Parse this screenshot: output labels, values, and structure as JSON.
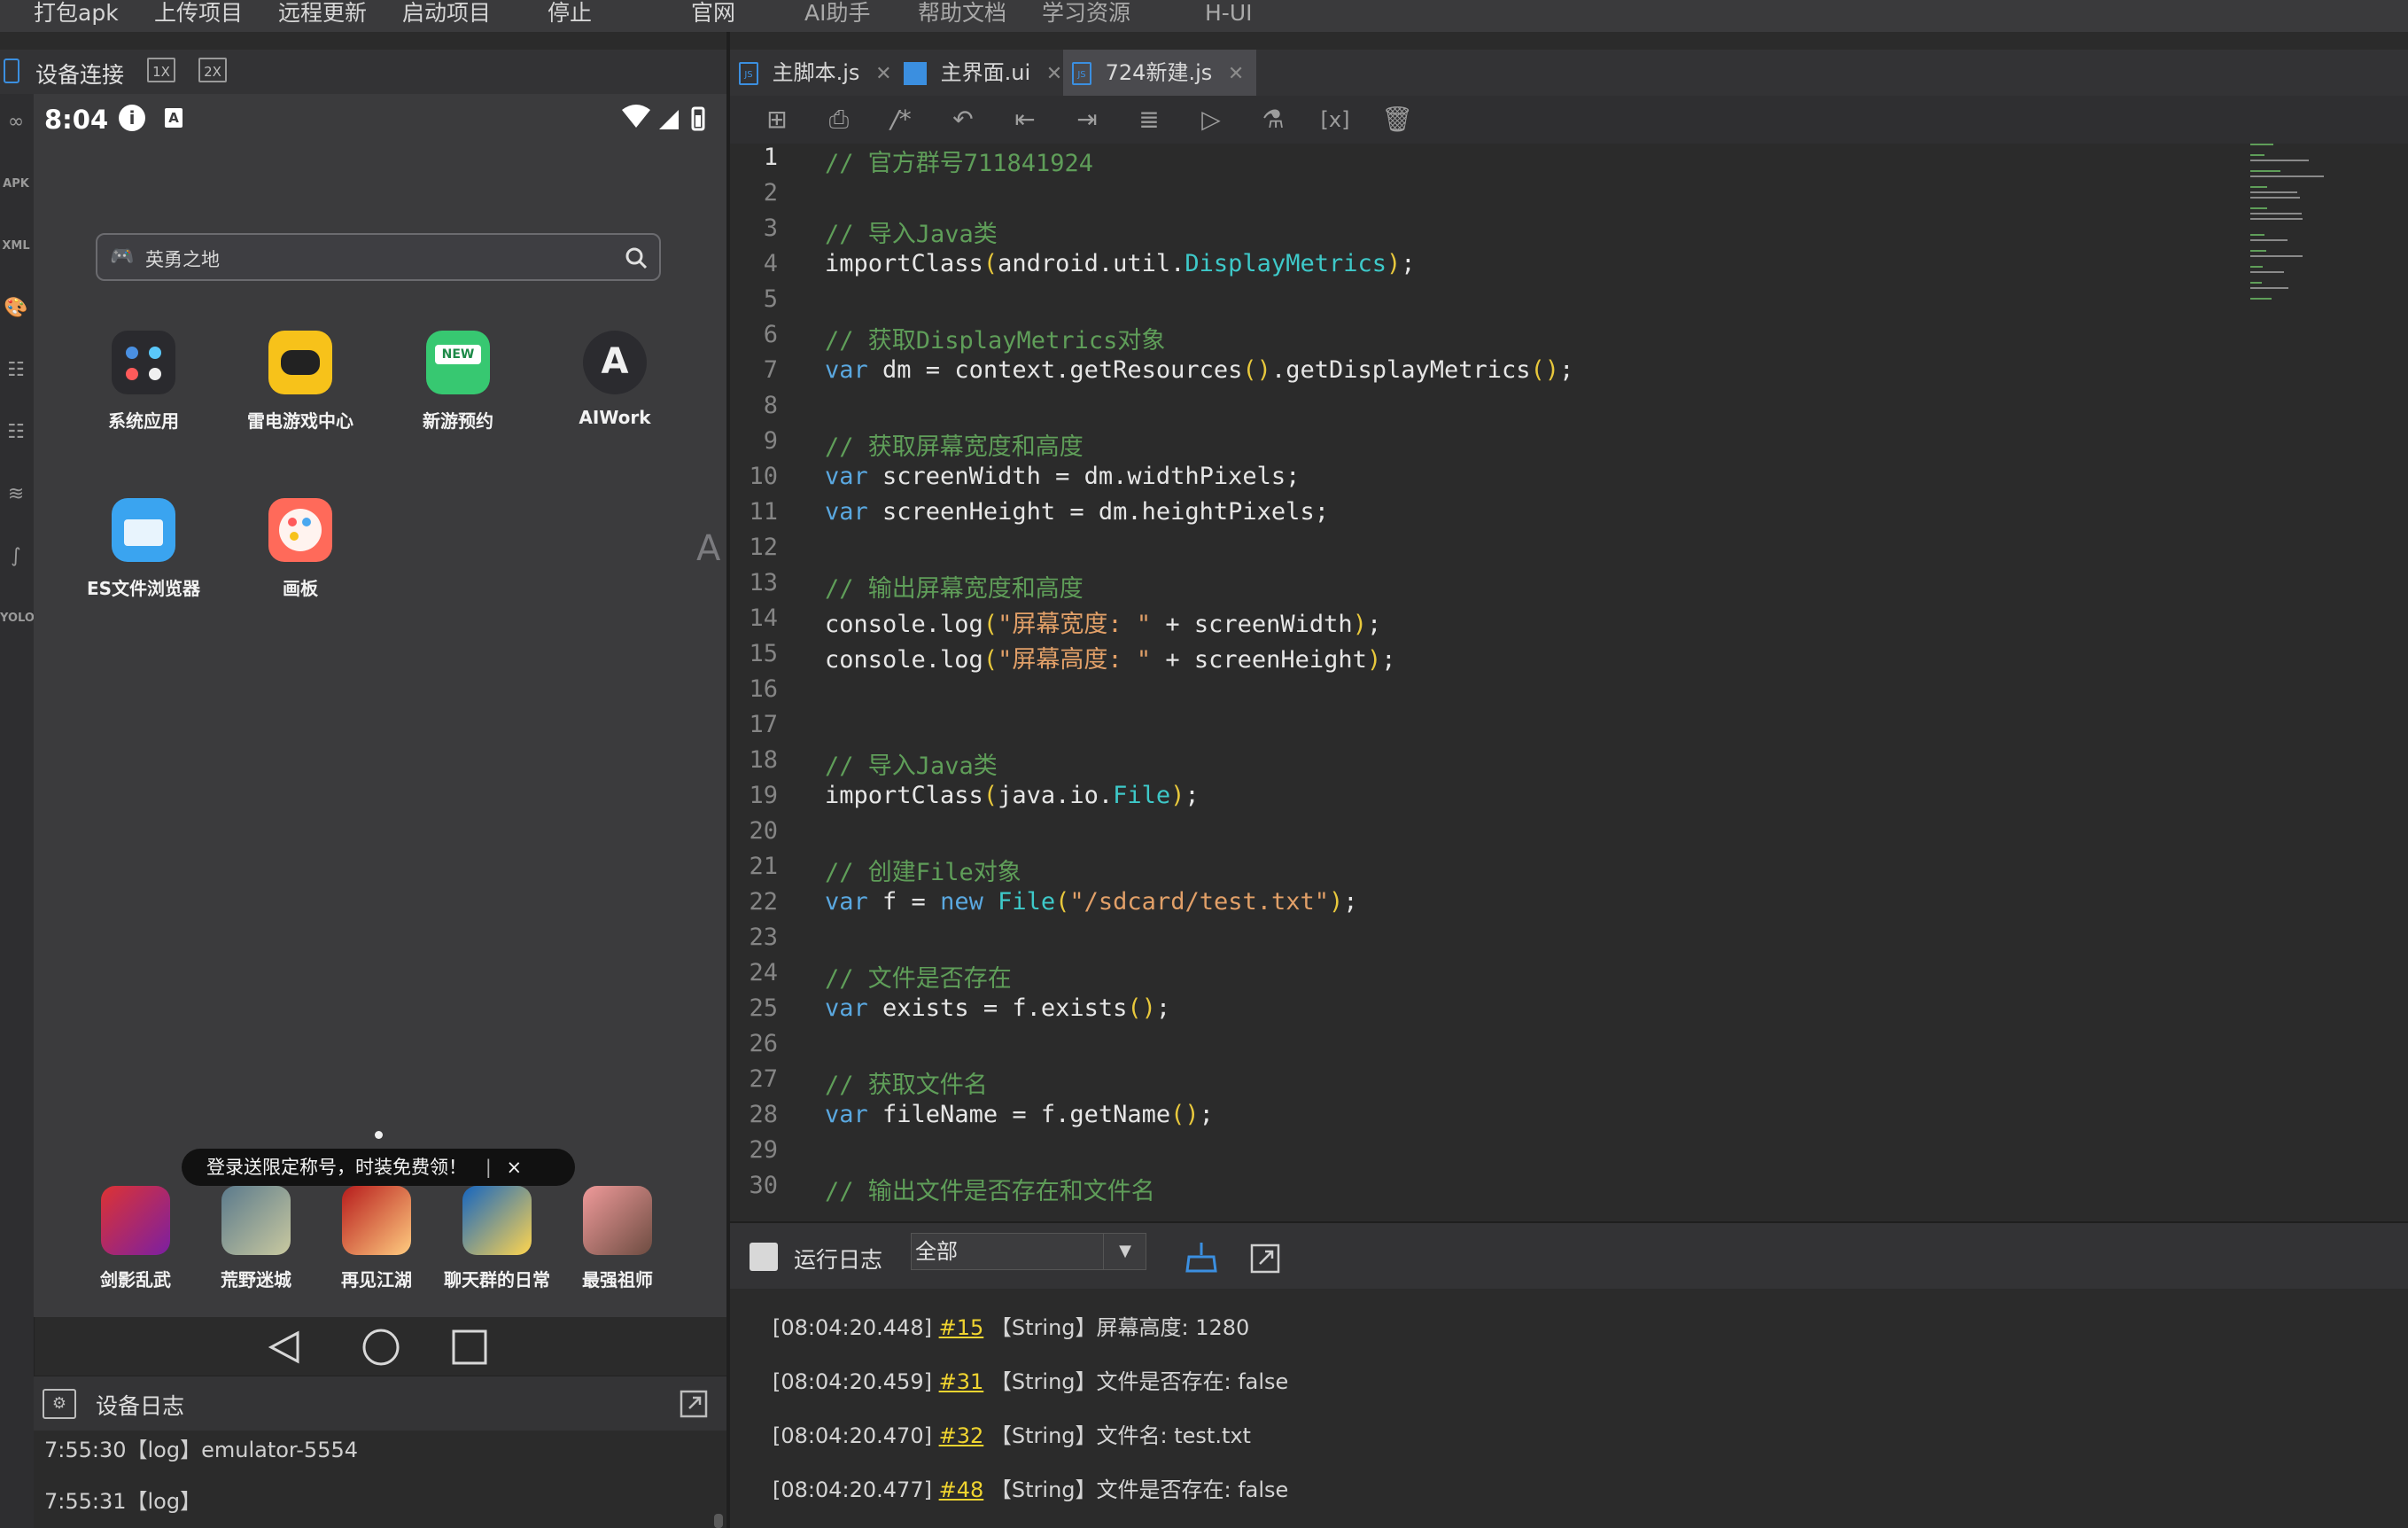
{
  "menubar": {
    "items": [
      "打包apk",
      "上传项目",
      "远程更新",
      "启动项目",
      "停止",
      "官网",
      "AI助手",
      "帮助文档",
      "学习资源",
      "H-UI"
    ]
  },
  "device_panel": {
    "title": "设备连接",
    "scale_1x": "1X",
    "scale_2x": "2X"
  },
  "phone": {
    "time": "8:04",
    "search_placeholder": "英勇之地",
    "apps": [
      {
        "label": "系统应用",
        "icon": "system-apps-icon"
      },
      {
        "label": "雷电游戏中心",
        "icon": "gamepad-icon"
      },
      {
        "label": "新游预约",
        "icon": "new-game-icon"
      },
      {
        "label": "AIWork",
        "icon": "aiwork-icon"
      },
      {
        "label": "ES文件浏览器",
        "icon": "folder-icon"
      },
      {
        "label": "画板",
        "icon": "palette-icon"
      }
    ],
    "banner_text": "登录送限定称号，时装免费领！",
    "banner_close": "×",
    "games": [
      "剑影乱武",
      "荒野迷城",
      "再见江湖",
      "聊天群的日常",
      "最强祖师"
    ]
  },
  "device_log": {
    "title": "设备日志",
    "lines": [
      "7:55:30【log】emulator-5554",
      "7:55:31【log】"
    ]
  },
  "tabs": [
    {
      "label": "主脚本.js",
      "icon": "js-file-icon",
      "active": false
    },
    {
      "label": "主界面.ui",
      "icon": "ui-file-icon",
      "active": false
    },
    {
      "label": "724新建.js",
      "icon": "js-file-icon",
      "active": true
    }
  ],
  "toolbar": {
    "icons": [
      "add-icon",
      "print-icon",
      "comment-icon",
      "undo-icon",
      "outdent-icon",
      "indent-icon",
      "format-icon",
      "run-icon",
      "flask-icon",
      "variable-icon",
      "clear-icon"
    ]
  },
  "editor": {
    "current_line": 1,
    "lines": [
      [
        [
          "cm",
          "// 官方群号711841924"
        ]
      ],
      [],
      [
        [
          "cm",
          "// 导入Java类"
        ]
      ],
      [
        [
          "",
          "importClass"
        ],
        [
          "pn",
          "("
        ],
        [
          "",
          "android.util."
        ],
        [
          "ty",
          "DisplayMetrics"
        ],
        [
          "pn",
          ")"
        ],
        [
          "",
          ";"
        ]
      ],
      [],
      [
        [
          "cm",
          "// 获取DisplayMetrics对象"
        ]
      ],
      [
        [
          "kw",
          "var"
        ],
        [
          "",
          " dm = context.getResources"
        ],
        [
          "pn",
          "()"
        ],
        [
          "",
          ".getDisplayMetrics"
        ],
        [
          "pn",
          "()"
        ],
        [
          "",
          ";"
        ]
      ],
      [],
      [
        [
          "cm",
          "// 获取屏幕宽度和高度"
        ]
      ],
      [
        [
          "kw",
          "var"
        ],
        [
          "",
          " screenWidth = dm.widthPixels;"
        ]
      ],
      [
        [
          "kw",
          "var"
        ],
        [
          "",
          " screenHeight = dm.heightPixels;"
        ]
      ],
      [],
      [
        [
          "cm",
          "// 输出屏幕宽度和高度"
        ]
      ],
      [
        [
          "",
          "console.log"
        ],
        [
          "pn",
          "("
        ],
        [
          "st",
          "\"屏幕宽度: \""
        ],
        [
          "",
          " + screenWidth"
        ],
        [
          "pn",
          ")"
        ],
        [
          "",
          ";"
        ]
      ],
      [
        [
          "",
          "console.log"
        ],
        [
          "pn",
          "("
        ],
        [
          "st",
          "\"屏幕高度: \""
        ],
        [
          "",
          " + screenHeight"
        ],
        [
          "pn",
          ")"
        ],
        [
          "",
          ";"
        ]
      ],
      [],
      [],
      [
        [
          "cm",
          "// 导入Java类"
        ]
      ],
      [
        [
          "",
          "importClass"
        ],
        [
          "pn",
          "("
        ],
        [
          "",
          "java.io."
        ],
        [
          "ty",
          "File"
        ],
        [
          "pn",
          ")"
        ],
        [
          "",
          ";"
        ]
      ],
      [],
      [
        [
          "cm",
          "// 创建File对象"
        ]
      ],
      [
        [
          "kw",
          "var"
        ],
        [
          "",
          " f = "
        ],
        [
          "kw",
          "new"
        ],
        [
          "",
          " "
        ],
        [
          "ty",
          "File"
        ],
        [
          "pn",
          "("
        ],
        [
          "st",
          "\"/sdcard/test.txt\""
        ],
        [
          "pn",
          ")"
        ],
        [
          "",
          ";"
        ]
      ],
      [],
      [
        [
          "cm",
          "// 文件是否存在"
        ]
      ],
      [
        [
          "kw",
          "var"
        ],
        [
          "",
          " exists = f.exists"
        ],
        [
          "pn",
          "()"
        ],
        [
          "",
          ";"
        ]
      ],
      [],
      [
        [
          "cm",
          "// 获取文件名"
        ]
      ],
      [
        [
          "kw",
          "var"
        ],
        [
          "",
          " fileName = f.getName"
        ],
        [
          "pn",
          "()"
        ],
        [
          "",
          ";"
        ]
      ],
      [],
      [
        [
          "cm",
          "// 输出文件是否存在和文件名"
        ]
      ]
    ]
  },
  "runlog": {
    "title": "运行日志",
    "filter_value": "全部",
    "entries": [
      {
        "time": "[08:04:20.448]",
        "link": "#15",
        "text": "【String】屏幕高度: 1280"
      },
      {
        "time": "[08:04:20.459]",
        "link": "#31",
        "text": "【String】文件是否存在: false"
      },
      {
        "time": "[08:04:20.470]",
        "link": "#32",
        "text": "【String】文件名: test.txt"
      },
      {
        "time": "[08:04:20.477]",
        "link": "#48",
        "text": "【String】文件是否存在: false"
      }
    ]
  },
  "colors": {
    "comment": "#5f9e59",
    "keyword": "#5aa8e0",
    "type": "#3ec9c9",
    "string": "#e2a068",
    "paren": "#e8c83c",
    "log_link": "#f0d430"
  }
}
